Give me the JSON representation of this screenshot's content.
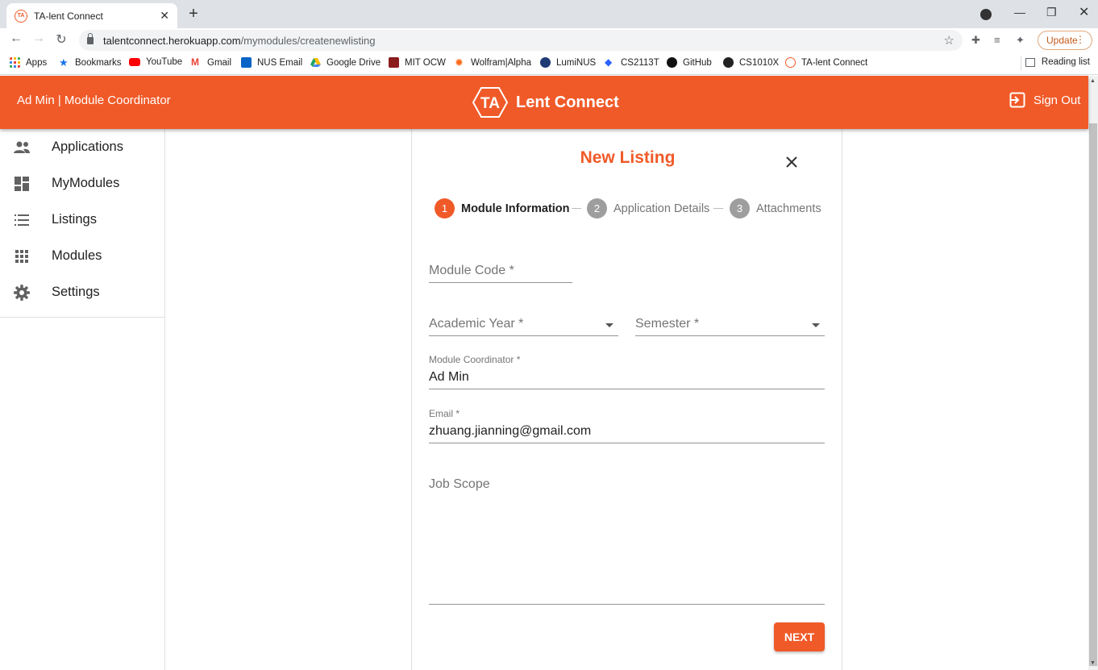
{
  "browser": {
    "tab_title": "TA-lent Connect",
    "tab_favicon_text": "TA",
    "url_host": "talentconnect.herokuapp.com",
    "url_path": "/mymodules/createnewlisting",
    "update_label": "Update",
    "bookmarks": [
      {
        "label": "Apps",
        "icon": "apps-grid-icon",
        "color": "#ea4335"
      },
      {
        "label": "Bookmarks",
        "icon": "star-icon",
        "color": "#1a73e8"
      },
      {
        "label": "YouTube",
        "icon": "youtube-icon",
        "color": "#ff0000"
      },
      {
        "label": "Gmail",
        "icon": "gmail-icon",
        "color": "#ea4335"
      },
      {
        "label": "NUS Email",
        "icon": "outlook-icon",
        "color": "#0a64c8"
      },
      {
        "label": "Google Drive",
        "icon": "drive-icon",
        "color": "#1fa463"
      },
      {
        "label": "MIT OCW",
        "icon": "mit-ocw-icon",
        "color": "#8a1c1c"
      },
      {
        "label": "Wolfram|Alpha",
        "icon": "wolfram-icon",
        "color": "#f96e1e"
      },
      {
        "label": "LumiNUS",
        "icon": "luminus-icon",
        "color": "#1f3b73"
      },
      {
        "label": "CS2113T",
        "icon": "graduation-cap-icon",
        "color": "#2962ff"
      },
      {
        "label": "GitHub",
        "icon": "github-icon",
        "color": "#111111"
      },
      {
        "label": "CS1010X",
        "icon": "cs1010x-icon",
        "color": "#222222"
      },
      {
        "label": "TA-lent Connect",
        "icon": "talent-connect-icon",
        "color": "#f05a28"
      }
    ],
    "reading_list": "Reading list"
  },
  "header": {
    "user_info": "Ad Min | Module Coordinator",
    "brand_logo_text": "TA",
    "brand_name": "Lent Connect",
    "sign_out": "Sign Out",
    "accent_color": "#f05a28"
  },
  "sidebar": {
    "items": [
      {
        "label": "Applications",
        "icon": "people-icon"
      },
      {
        "label": "MyModules",
        "icon": "dashboard-icon"
      },
      {
        "label": "Listings",
        "icon": "list-icon"
      },
      {
        "label": "Modules",
        "icon": "apps-icon"
      },
      {
        "label": "Settings",
        "icon": "gear-icon"
      }
    ]
  },
  "form": {
    "title": "New Listing",
    "steps": [
      {
        "number": "1",
        "label": "Module Information",
        "active": true
      },
      {
        "number": "2",
        "label": "Application Details",
        "active": false
      },
      {
        "number": "3",
        "label": "Attachments",
        "active": false
      }
    ],
    "module_code": {
      "placeholder": "Module Code *",
      "value": ""
    },
    "academic_year": {
      "placeholder": "Academic Year *",
      "value": ""
    },
    "semester": {
      "placeholder": "Semester *",
      "value": ""
    },
    "module_coordinator": {
      "label": "Module Coordinator *",
      "value": "Ad Min"
    },
    "email": {
      "label": "Email *",
      "value": "zhuang.jianning@gmail.com"
    },
    "job_scope": {
      "placeholder": "Job Scope",
      "value": ""
    },
    "next_label": "NEXT"
  }
}
